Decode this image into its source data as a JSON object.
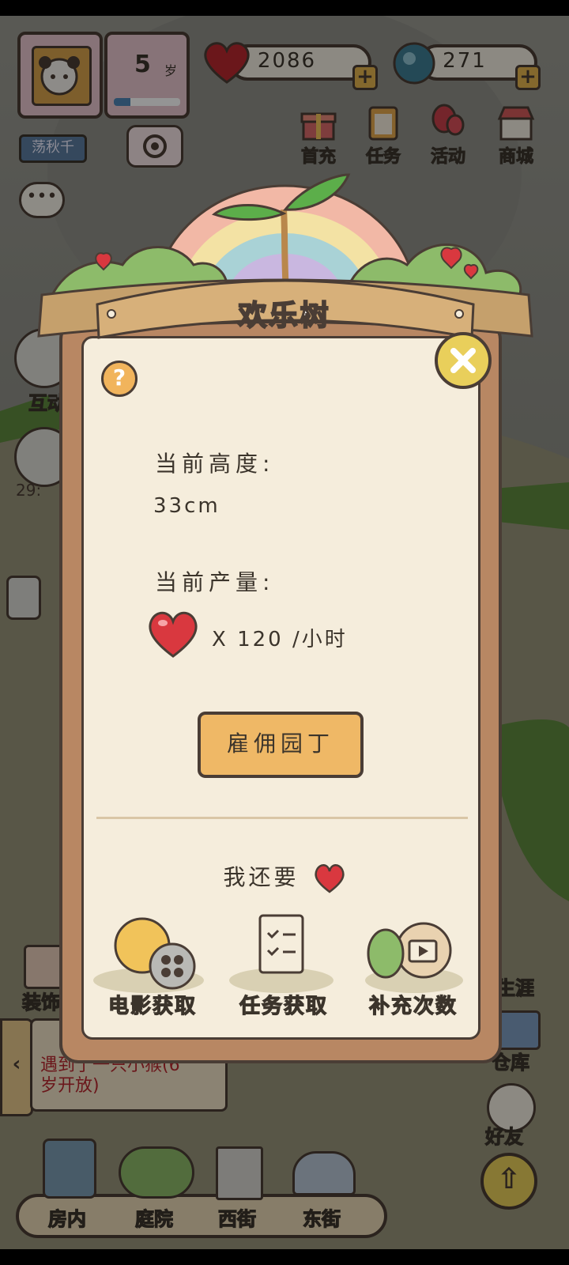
{
  "hud": {
    "age_number": "5",
    "age_unit": "岁",
    "age_progress": 0.25,
    "swing_label": "荡秋千",
    "hearts": "2086",
    "gems": "271",
    "menu": [
      {
        "label": "首充",
        "icon": "gift-icon"
      },
      {
        "label": "任务",
        "icon": "clipboard-icon"
      },
      {
        "label": "活动",
        "icon": "balloon-icon"
      },
      {
        "label": "商城",
        "icon": "shop-icon"
      }
    ]
  },
  "background": {
    "interact_label": "互动",
    "timer_text": "29:",
    "decor_label": "装饰",
    "career_label": "生涯",
    "warehouse_label": "仓库",
    "friends_label": "好友",
    "notice_line1": "遇到了一只小猴(6",
    "notice_line2": "岁开放)",
    "nav": [
      "房内",
      "庭院",
      "西街",
      "东街"
    ]
  },
  "panel": {
    "title": "欢乐树",
    "height_label": "当前高度:",
    "height_value": "33cm",
    "output_label": "当前产量:",
    "output_value": "X 120 /小时",
    "hire_button": "雇佣园丁",
    "want_more": "我还要",
    "options": [
      {
        "label": "电影获取",
        "icon": "film-reel-icon"
      },
      {
        "label": "任务获取",
        "icon": "checklist-icon"
      },
      {
        "label": "补充次数",
        "icon": "video-refill-icon"
      }
    ]
  },
  "colors": {
    "heart": "#d9383f",
    "button": "#efb866",
    "panel_bg": "#f5eddc",
    "frame": "#b88763",
    "outline": "#4a3d35"
  }
}
